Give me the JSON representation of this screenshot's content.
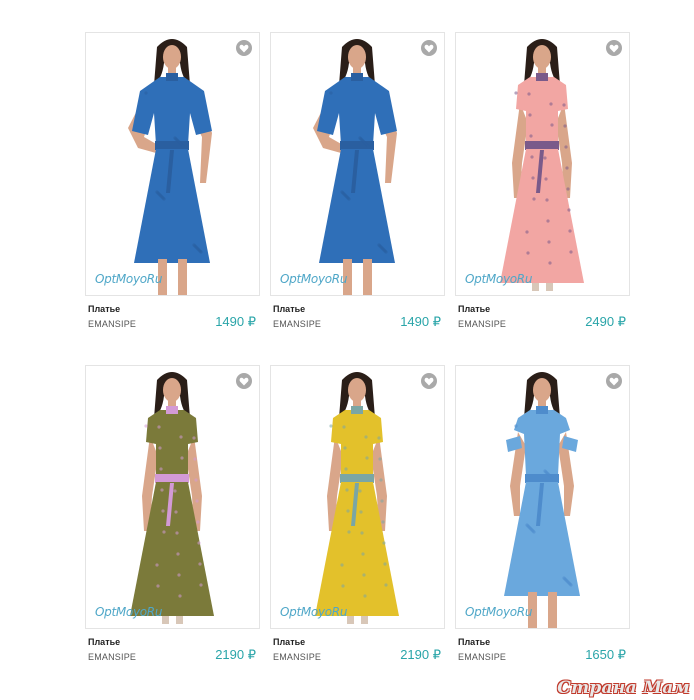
{
  "products": [
    {
      "name": "Платье",
      "brand": "EMANSIPE",
      "price": "1490 ₽",
      "watermark": "OptMoyoRu",
      "dress_color": "#2f6fb8",
      "accent_color": "#2a5fa0",
      "hem": "knee",
      "sleeve": "wide"
    },
    {
      "name": "Платье",
      "brand": "EMANSIPE",
      "price": "1490 ₽",
      "watermark": "OptMoyoRu",
      "dress_color": "#2f6fb8",
      "accent_color": "#2a5fa0",
      "hem": "knee",
      "sleeve": "wide"
    },
    {
      "name": "Платье",
      "brand": "EMANSIPE",
      "price": "2490 ₽",
      "watermark": "OptMoyoRu",
      "dress_color": "#f2a6a3",
      "accent_color": "#7a5a8a",
      "hem": "maxi",
      "sleeve": "short"
    },
    {
      "name": "Платье",
      "brand": "EMANSIPE",
      "price": "2190 ₽",
      "watermark": "OptMoyoRu",
      "dress_color": "#7b7a3a",
      "accent_color": "#d39ad6",
      "hem": "maxi",
      "sleeve": "short"
    },
    {
      "name": "Платье",
      "brand": "EMANSIPE",
      "price": "2190 ₽",
      "watermark": "OptMoyoRu",
      "dress_color": "#e3c12b",
      "accent_color": "#7aa6a5",
      "hem": "maxi",
      "sleeve": "short"
    },
    {
      "name": "Платье",
      "brand": "EMANSIPE",
      "price": "1650 ₽",
      "watermark": "OptMoyoRu",
      "dress_color": "#6aa8dd",
      "accent_color": "#4e8ccc",
      "hem": "knee",
      "sleeve": "cold"
    }
  ],
  "footer_watermark": "Страна Мам",
  "favorite_icon": "heart-icon"
}
